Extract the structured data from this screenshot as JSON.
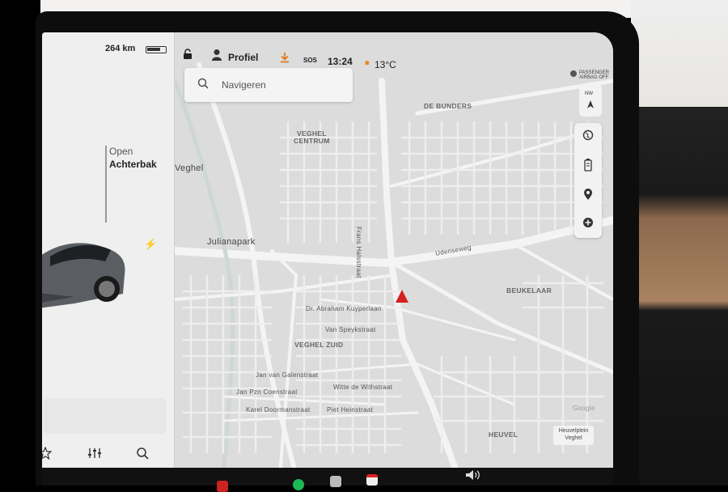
{
  "car_panel": {
    "range": "264 km",
    "trunk_status": "Open",
    "trunk_name": "Achterbak",
    "charging_icon": "lightning-icon",
    "bottom_icons": [
      "star-icon",
      "sliders-icon",
      "search-icon"
    ]
  },
  "status_bar": {
    "lock_icon": "unlock-icon",
    "profile_label": "Profiel",
    "download_icon": "download-icon",
    "sos_label": "SOS",
    "time": "13:24",
    "temperature": "13°C"
  },
  "search": {
    "placeholder": "Navigeren"
  },
  "map": {
    "labels": [
      {
        "text": "DE BUNDERS",
        "kind": "dist"
      },
      {
        "text": "VEGHEL",
        "kind": "dist"
      },
      {
        "text": "CENTRUM",
        "kind": "dist"
      },
      {
        "text": "Veghel",
        "kind": "big"
      },
      {
        "text": "Julianapark",
        "kind": "big"
      },
      {
        "text": "Frans Halsstraat",
        "kind": "street"
      },
      {
        "text": "Udenseweg",
        "kind": "street"
      },
      {
        "text": "BEUKELAAR",
        "kind": "dist"
      },
      {
        "text": "Dr. Abraham Kuyperlaan",
        "kind": "street"
      },
      {
        "text": "Van Speykstraat",
        "kind": "street"
      },
      {
        "text": "VEGHEL ZUID",
        "kind": "dist"
      },
      {
        "text": "Jan van Galenstraat",
        "kind": "street"
      },
      {
        "text": "Jan Pzn Coenstraat",
        "kind": "street"
      },
      {
        "text": "Witte de Withstraat",
        "kind": "street"
      },
      {
        "text": "Karel Doormanstraat",
        "kind": "street"
      },
      {
        "text": "Piet Heinstraat",
        "kind": "street"
      },
      {
        "text": "HEUVEL",
        "kind": "dist"
      },
      {
        "text": "Google",
        "kind": "street"
      }
    ],
    "corner_label": "Heuvelplein Veghel",
    "badge_text": "PASSENGER AIRBAG OFF"
  },
  "map_controls": [
    "compass-icon",
    "globe-icon",
    "battery-icon",
    "pin-icon",
    "plus-icon"
  ],
  "colors": {
    "nav_arrow": "#d62020",
    "map_bg": "#dcdcdc",
    "road": "#f3f3f3"
  }
}
